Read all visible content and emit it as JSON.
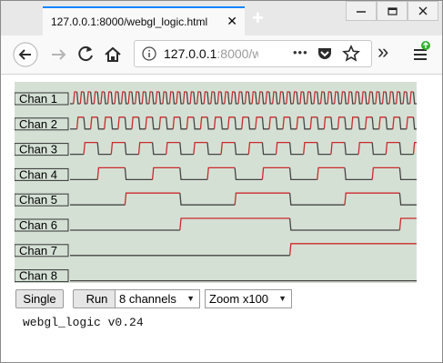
{
  "browser": {
    "tab_title": "127.0.0.1:8000/webgl_logic.html",
    "tab_close": "✕",
    "new_tab": "+",
    "url_host": "127.0.0.1",
    "url_rest": ":8000/w",
    "page_actions": "•••",
    "overflow": "»"
  },
  "analyzer": {
    "channels": [
      {
        "label": "Chan 1",
        "period": 1
      },
      {
        "label": "Chan 2",
        "period": 2
      },
      {
        "label": "Chan 3",
        "period": 4
      },
      {
        "label": "Chan 4",
        "period": 8
      },
      {
        "label": "Chan 5",
        "period": 16
      },
      {
        "label": "Chan 6",
        "period": 32
      },
      {
        "label": "Chan 7",
        "period": 64
      },
      {
        "label": "Chan 8",
        "period": 128
      }
    ],
    "colors": {
      "background": "#d5e0d5",
      "high": "#cc2a2a",
      "low": "#444444",
      "label_bg": "#d5e0d5"
    }
  },
  "controls": {
    "single_label": "Single",
    "run_label": "Run",
    "channels_value": "8 channels",
    "zoom_value": "Zoom x100"
  },
  "footer": {
    "version": "webgl_logic v0.24"
  }
}
